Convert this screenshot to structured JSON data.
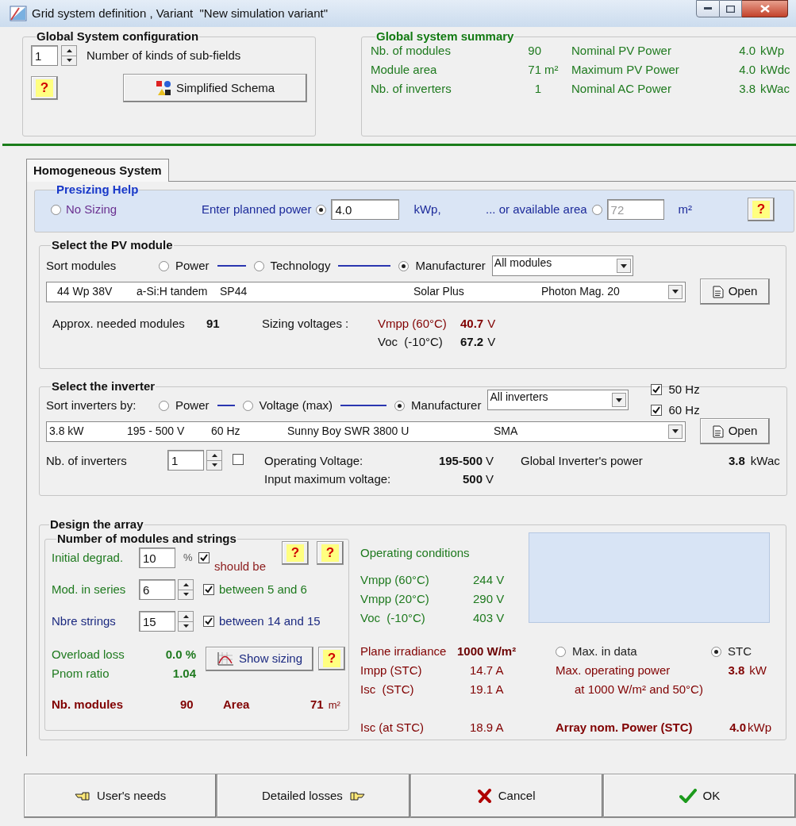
{
  "window": {
    "title": "Grid system definition , Variant  \"New simulation variant\""
  },
  "global_config": {
    "title": "Global System configuration",
    "subfields_value": "1",
    "subfields_label": "Number of kinds of sub-fields",
    "help": "?",
    "schema_button": "Simplified Schema"
  },
  "summary": {
    "title": "Global system summary",
    "rows": [
      {
        "label": "Nb. of modules",
        "value": "90",
        "label2": "Nominal PV Power",
        "value2": "4.0",
        "unit2": "kWp"
      },
      {
        "label": "Module area",
        "value": "71",
        "unit": "m²",
        "label2": "Maximum PV Power",
        "value2": "4.0",
        "unit2": "kWdc"
      },
      {
        "label": "Nb. of inverters",
        "value": "1",
        "label2": "Nominal AC Power",
        "value2": "3.8",
        "unit2": "kWac"
      }
    ]
  },
  "tabs": [
    {
      "label": "Homogeneous System",
      "selected": true
    }
  ],
  "presizing": {
    "title": "Presizing Help",
    "options": [
      {
        "label": "No Sizing",
        "selected": false
      },
      {
        "label": "Enter planned power",
        "selected": true,
        "value": "4.0",
        "unit": "kWp,"
      },
      {
        "label": "... or available area",
        "selected": false,
        "value": "72",
        "unit": "m²"
      }
    ],
    "help": "?"
  },
  "pv_module": {
    "title": "Select the PV module",
    "sort_label": "Sort modules",
    "sort_options": [
      {
        "label": "Power",
        "selected": false
      },
      {
        "label": "Technology",
        "selected": false
      },
      {
        "label": "Manufacturer",
        "selected": true
      }
    ],
    "filter": "All modules",
    "selection": [
      "44 Wp 38V",
      "a-Si:H tandem",
      "SP44",
      "Solar Plus",
      "Photon Mag. 20"
    ],
    "open": "Open",
    "needed_label": "Approx. needed modules",
    "needed_value": "91",
    "sizing_label": "Sizing voltages :",
    "voltages": [
      {
        "label": "Vmpp (60°C)",
        "value": "40.7",
        "unit": "V",
        "highlight": true
      },
      {
        "label": "Voc  (-10°C)",
        "value": "67.2",
        "unit": "V",
        "highlight": false
      }
    ]
  },
  "inverter": {
    "title": "Select the inverter",
    "sort_label": "Sort inverters by:",
    "sort_options": [
      {
        "label": "Power",
        "selected": false
      },
      {
        "label": "Voltage (max)",
        "selected": false
      },
      {
        "label": "Manufacturer",
        "selected": true
      }
    ],
    "filter": "All inverters",
    "freq": [
      {
        "label": "50 Hz",
        "checked": true
      },
      {
        "label": "60 Hz",
        "checked": true
      }
    ],
    "selection": [
      "3.8 kW",
      "195 - 500 V",
      "60 Hz",
      "Sunny Boy SWR 3800 U",
      "SMA"
    ],
    "open": "Open",
    "count_label": "Nb. of inverters",
    "count": "1",
    "count_checked": false,
    "voltages": [
      {
        "label": "Operating Voltage:",
        "value": "195-500",
        "unit": "V"
      },
      {
        "label": "Input maximum voltage:",
        "value": "500",
        "unit": "V"
      }
    ],
    "power_label": "Global Inverter's power",
    "power_value": "3.8",
    "power_unit": "kWac"
  },
  "array": {
    "title": "Design the array",
    "strings": {
      "title": "Number of modules and strings",
      "rows": [
        {
          "label": "Initial degrad.",
          "value": "10",
          "unit": "%",
          "checked": true,
          "note": "should be",
          "kind": "plain",
          "color": "#1f7a1f"
        },
        {
          "label": "Mod. in series",
          "value": "6",
          "checked": true,
          "note": "between 5 and 6",
          "kind": "spin",
          "color": "#1f7a1f"
        },
        {
          "label": "Nbre strings",
          "value": "15",
          "checked": true,
          "note": "between 14 and 15",
          "kind": "spin",
          "color": "#1c2a80"
        }
      ],
      "helps": [
        "?",
        "?"
      ],
      "overload_label": "Overload loss",
      "overload_value": "0.0 %",
      "pnom_label": "Pnom ratio",
      "pnom_value": "1.04",
      "show_sizing": "Show sizing",
      "sizing_help": "?",
      "modules_label": "Nb. modules",
      "modules_value": "90",
      "area_label": "Area",
      "area_value": "71",
      "area_unit": "m²"
    },
    "operating": {
      "title": "Operating conditions",
      "rows": [
        {
          "label": "Vmpp (60°C)",
          "value": "244 V"
        },
        {
          "label": "Vmpp (20°C)",
          "value": "290 V"
        },
        {
          "label": "Voc  (-10°C)",
          "value": "403 V"
        }
      ]
    },
    "irradiance": {
      "label": "Plane irradiance",
      "value": "1000 W/m²",
      "options": [
        {
          "label": "Max. in data",
          "selected": false
        },
        {
          "label": "STC",
          "selected": true
        }
      ]
    },
    "currents": [
      {
        "label": "Impp (STC)",
        "value": "14.7 A"
      },
      {
        "label": "Isc  (STC)",
        "value": "19.1 A"
      }
    ],
    "max_power": {
      "label": "Max. operating power",
      "value": "3.8",
      "unit": "kW",
      "note": "at 1000 W/m² and 50°C)"
    },
    "isc": {
      "label": "Isc (at STC)",
      "value": "18.9 A"
    },
    "nominal": {
      "label": "Array nom. Power (STC)",
      "value": "4.0",
      "unit": "kWp"
    }
  },
  "buttons": [
    {
      "label": "User's needs",
      "kind": "back"
    },
    {
      "label": "Detailed losses",
      "kind": "forward"
    },
    {
      "label": "Cancel",
      "kind": "cancel"
    },
    {
      "label": "OK",
      "kind": "ok"
    }
  ]
}
